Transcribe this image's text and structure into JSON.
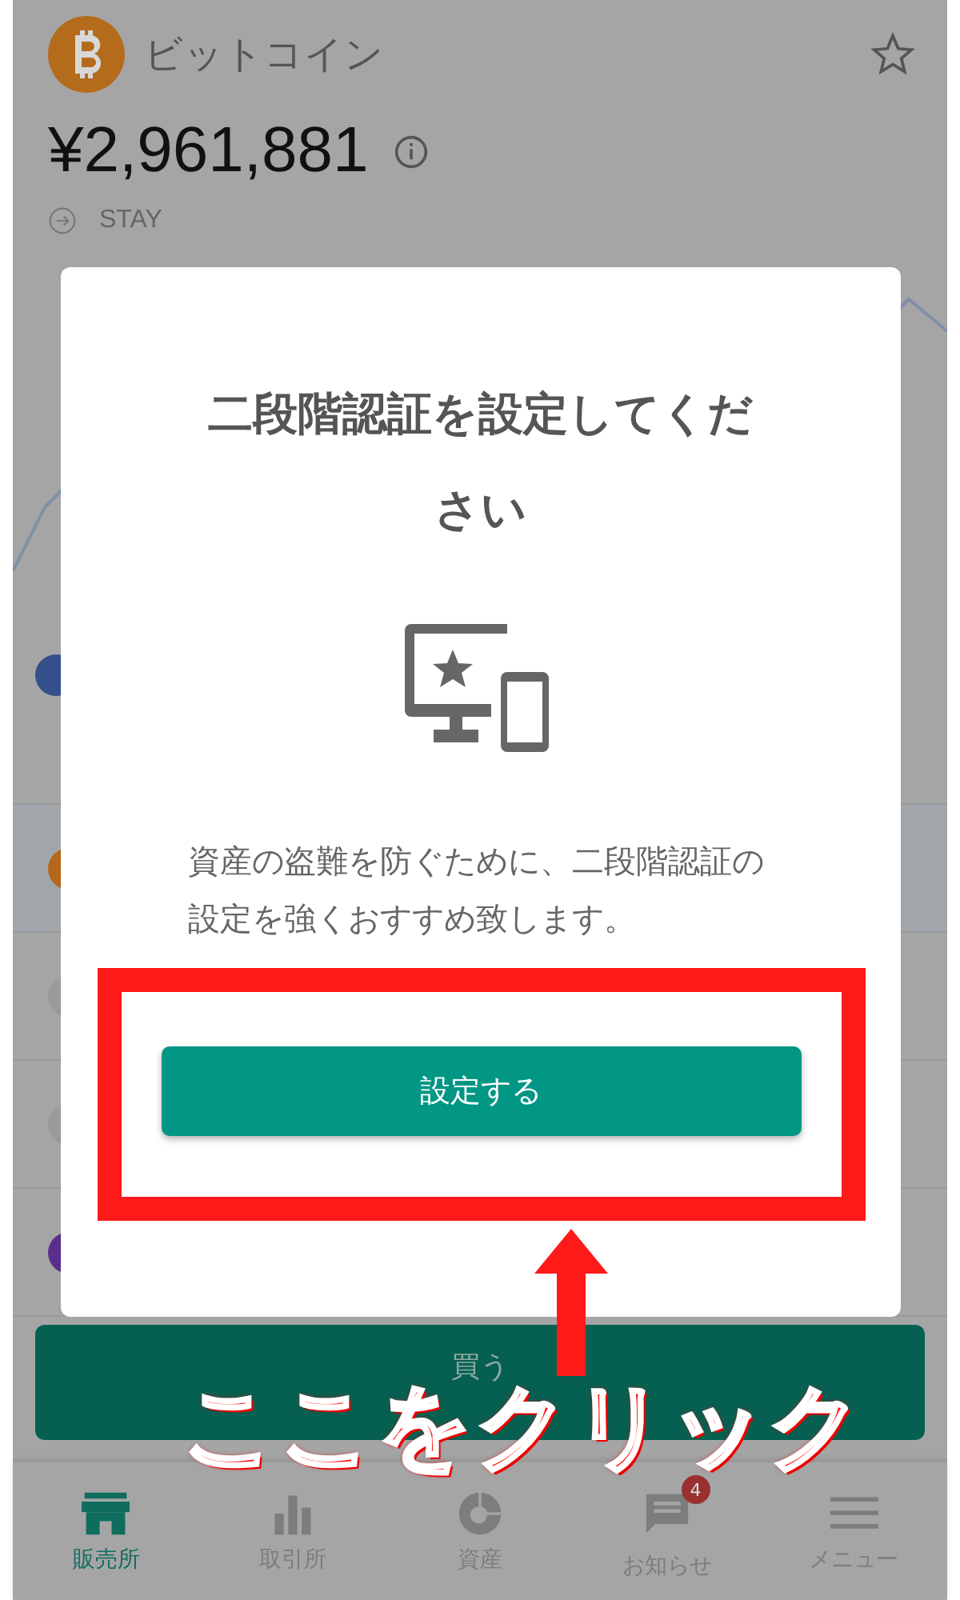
{
  "coin": {
    "name": "ビットコイン",
    "price": "¥2,961,881",
    "status": "STAY"
  },
  "buy_button": {
    "label": "買う"
  },
  "bottom_nav": [
    {
      "label": "販売所",
      "selected": true,
      "kind": "shop"
    },
    {
      "label": "取引所",
      "selected": false,
      "kind": "bars"
    },
    {
      "label": "資産",
      "selected": false,
      "kind": "pie"
    },
    {
      "label": "お知らせ",
      "selected": false,
      "kind": "chat",
      "badge": "4"
    },
    {
      "label": "メニュー",
      "selected": false,
      "kind": "menu"
    }
  ],
  "dialog": {
    "title": "二段階認証を設定してください",
    "message": "資産の盗難を防ぐために、二段階認証の設定を強くおすすめ致します。",
    "button": "設定する"
  },
  "annotation": {
    "text": "ここをクリック"
  }
}
